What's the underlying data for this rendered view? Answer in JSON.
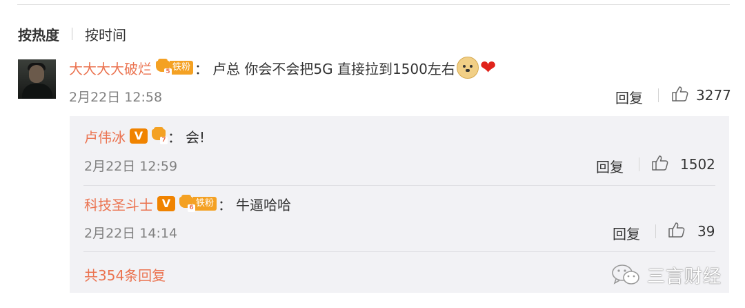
{
  "sort": {
    "hot_label": "按热度",
    "time_label": "按时间"
  },
  "comment": {
    "username": "大大大大破烂",
    "fan_level": "5",
    "fan_tag": "铁粉",
    "colon": "：",
    "text": "卢总 你会不会把5G 直接拉到1500左右",
    "emojis": [
      "doge-emoji",
      "heart-emoji"
    ],
    "time": "2月22日 12:58",
    "reply_label": "回复",
    "likes": "3277"
  },
  "replies": [
    {
      "username": "卢伟冰",
      "verified_label": "V",
      "fan_level": "7",
      "fan_tag": "",
      "colon": "：",
      "text": "会!",
      "time": "2月22日 12:59",
      "reply_label": "回复",
      "likes": "1502"
    },
    {
      "username": "科技圣斗士",
      "verified_label": "V",
      "fan_level": "6",
      "fan_tag": "铁粉",
      "colon": "：",
      "text": "牛逼哈哈",
      "time": "2月22日 14:14",
      "reply_label": "回复",
      "likes": "39"
    }
  ],
  "more_replies_label": "共354条回复",
  "watermark": {
    "text": "三言财经",
    "icon": "wechat-icon"
  },
  "colors": {
    "username": "#eb7350",
    "fan_badge": "#f4a123",
    "verified": "#f08300",
    "reply_bg": "#f2f2f5",
    "meta": "#808080"
  }
}
